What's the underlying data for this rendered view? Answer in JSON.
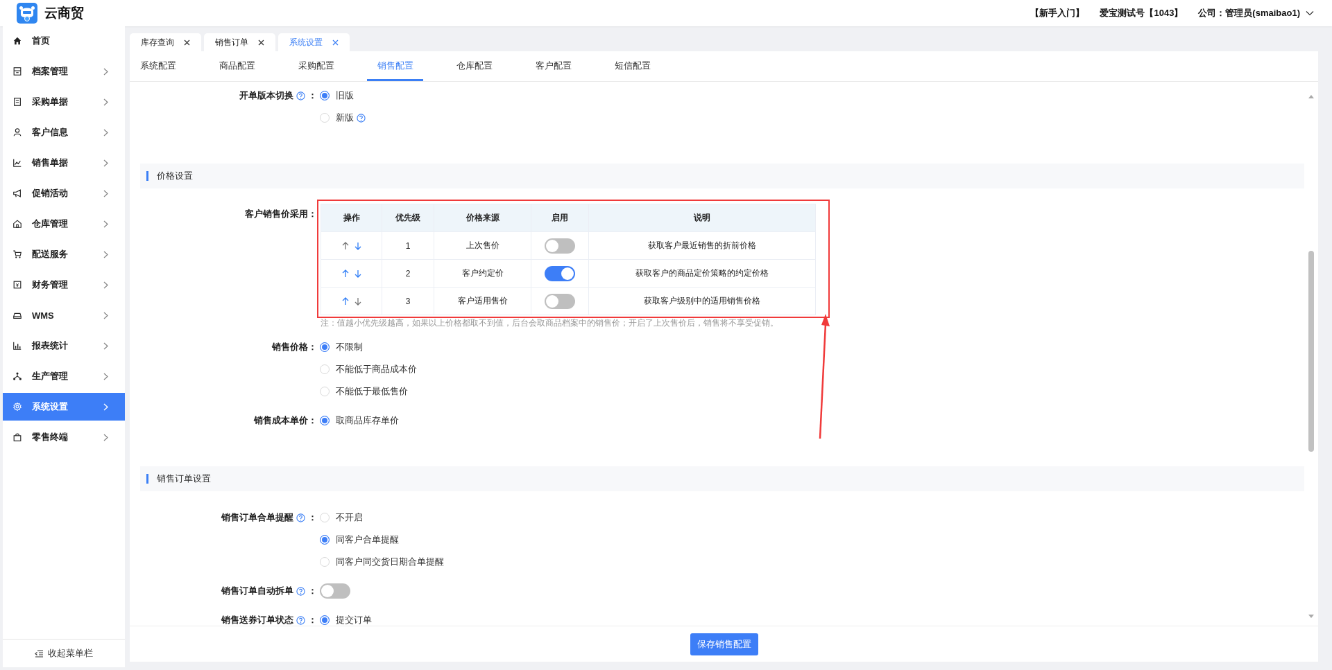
{
  "app": {
    "name": "云商贸"
  },
  "header": {
    "links": [
      "【新手入门】",
      "爱宝测试号【1043】"
    ],
    "company_label": "公司：",
    "user": "管理员(smaibao1)"
  },
  "sidebar": {
    "items": [
      {
        "label": "首页",
        "expandable": false,
        "selected": false
      },
      {
        "label": "档案管理",
        "expandable": true,
        "selected": false
      },
      {
        "label": "采购单据",
        "expandable": true,
        "selected": false
      },
      {
        "label": "客户信息",
        "expandable": true,
        "selected": false
      },
      {
        "label": "销售单据",
        "expandable": true,
        "selected": false
      },
      {
        "label": "促销活动",
        "expandable": true,
        "selected": false
      },
      {
        "label": "仓库管理",
        "expandable": true,
        "selected": false
      },
      {
        "label": "配送服务",
        "expandable": true,
        "selected": false
      },
      {
        "label": "财务管理",
        "expandable": true,
        "selected": false
      },
      {
        "label": "WMS",
        "expandable": true,
        "selected": false
      },
      {
        "label": "报表统计",
        "expandable": true,
        "selected": false
      },
      {
        "label": "生产管理",
        "expandable": true,
        "selected": false
      },
      {
        "label": "系统设置",
        "expandable": true,
        "selected": true
      },
      {
        "label": "零售终端",
        "expandable": true,
        "selected": false
      }
    ],
    "collapse": "收起菜单栏"
  },
  "open_tabs": [
    {
      "label": "库存查询",
      "selected": false
    },
    {
      "label": "销售订单",
      "selected": false
    },
    {
      "label": "系统设置",
      "selected": true
    }
  ],
  "config_tabs": [
    {
      "label": "系统配置",
      "selected": false
    },
    {
      "label": "商品配置",
      "selected": false
    },
    {
      "label": "采购配置",
      "selected": false
    },
    {
      "label": "销售配置",
      "selected": true
    },
    {
      "label": "仓库配置",
      "selected": false
    },
    {
      "label": "客户配置",
      "selected": false
    },
    {
      "label": "短信配置",
      "selected": false
    }
  ],
  "content": [
    {
      "kind": "radio",
      "label": "开单版本切换",
      "help": true,
      "suffix": "：",
      "options": [
        {
          "label": "旧版",
          "selected": true,
          "help": false
        },
        {
          "label": "新版",
          "selected": false,
          "help": true
        }
      ]
    },
    {
      "kind": "section",
      "title": "价格设置"
    },
    {
      "kind": "table",
      "label": "客户销售价采用：",
      "columns": [
        "操作",
        "优先级",
        "价格来源",
        "启用",
        "说明"
      ],
      "rows": [
        {
          "can_move_up": false,
          "can_move_down": true,
          "priority": "1",
          "source": "上次售价",
          "enabled": false,
          "description": "获取客户最近销售的折前价格"
        },
        {
          "can_move_up": true,
          "can_move_down": true,
          "priority": "2",
          "source": "客户约定价",
          "enabled": true,
          "description": "获取客户的商品定价策略的约定价格"
        },
        {
          "can_move_up": true,
          "can_move_down": false,
          "priority": "3",
          "source": "客户适用售价",
          "enabled": false,
          "description": "获取客户级别中的适用销售价格"
        }
      ],
      "note": "注：值越小优先级越高，如果以上价格都取不到值，后台会取商品档案中的销售价；开启了上次售价后，销售将不享受促销。"
    },
    {
      "kind": "radio",
      "label": "销售价格：",
      "help": false,
      "options": [
        {
          "label": "不限制",
          "selected": true,
          "help": false
        },
        {
          "label": "不能低于商品成本价",
          "selected": false,
          "help": false
        },
        {
          "label": "不能低于最低售价",
          "selected": false,
          "help": false
        }
      ]
    },
    {
      "kind": "radio",
      "label": "销售成本单价：",
      "help": false,
      "options": [
        {
          "label": "取商品库存单价",
          "selected": true,
          "help": false
        }
      ]
    },
    {
      "kind": "section",
      "title": "销售订单设置"
    },
    {
      "kind": "radio",
      "label": "销售订单合单提醒",
      "help": true,
      "suffix": "：",
      "options": [
        {
          "label": "不开启",
          "selected": false,
          "help": false
        },
        {
          "label": "同客户合单提醒",
          "selected": true,
          "help": false
        },
        {
          "label": "同客户同交货日期合单提醒",
          "selected": false,
          "help": false
        }
      ]
    },
    {
      "kind": "switch",
      "label": "销售订单自动拆单",
      "help": true,
      "suffix": "：",
      "on": false
    },
    {
      "kind": "radio",
      "label": "销售送券订单状态",
      "help": true,
      "suffix": "：",
      "options": [
        {
          "label": "提交订单",
          "selected": true,
          "help": false
        }
      ]
    }
  ],
  "save_button": "保存销售配置"
}
